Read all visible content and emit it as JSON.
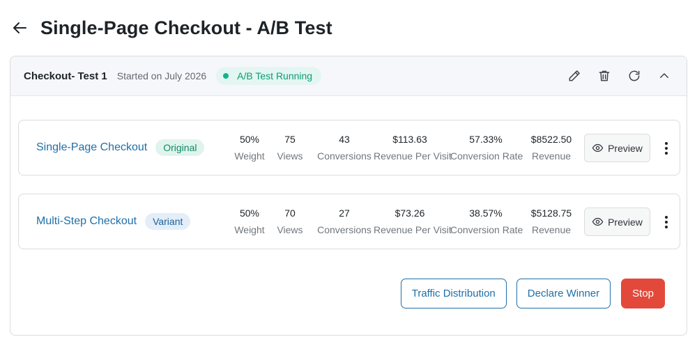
{
  "page": {
    "title": "Single-Page Checkout - A/B Test"
  },
  "test": {
    "name": "Checkout- Test 1",
    "started": "Started on July 2026",
    "status": "A/B Test Running",
    "colors": {
      "status": "#14b38a",
      "accent": "#1f6fa8",
      "danger": "#e2493a"
    }
  },
  "icons": {
    "back": "arrow-left-icon",
    "edit": "pencil-icon",
    "delete": "trash-icon",
    "refresh": "refresh-icon",
    "collapse": "chevron-up-icon",
    "preview": "eye-icon",
    "more": "kebab-icon"
  },
  "stat_labels": {
    "weight": "Weight",
    "views": "Views",
    "conversions": "Conversions",
    "rpv": "Revenue Per Visit",
    "conv_rate": "Conversion Rate",
    "revenue": "Revenue"
  },
  "variants": [
    {
      "name": "Single-Page Checkout",
      "badge": "Original",
      "weight": "50%",
      "views": "75",
      "conversions": "43",
      "rpv": "$113.63",
      "conv_rate": "57.33%",
      "revenue": "$8522.50",
      "preview_label": "Preview"
    },
    {
      "name": "Multi-Step Checkout",
      "badge": "Variant",
      "weight": "50%",
      "views": "70",
      "conversions": "27",
      "rpv": "$73.26",
      "conv_rate": "38.57%",
      "revenue": "$5128.75",
      "preview_label": "Preview"
    }
  ],
  "actions": {
    "traffic": "Traffic Distribution",
    "declare": "Declare Winner",
    "stop": "Stop"
  }
}
